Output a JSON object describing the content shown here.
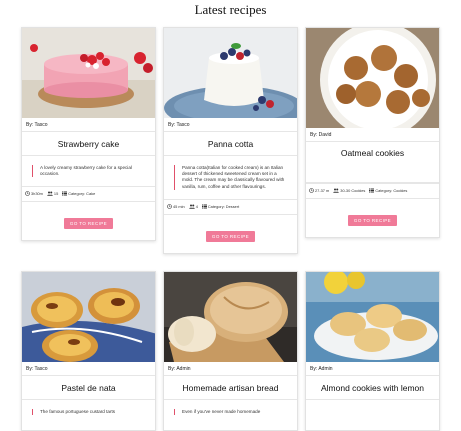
{
  "page": {
    "title": "Latest recipes"
  },
  "colors": {
    "accent": "#f07a98",
    "quote_bar": "#e0506a"
  },
  "recipes": [
    {
      "author": "By: Tasco",
      "title": "Strawberry cake",
      "description": "A lovely creamy strawberry cake for a special occasion.",
      "time": "3h30m",
      "servings": "15",
      "category": "Category: Cake",
      "button": "GO TO RECIPE"
    },
    {
      "author": "By: Tasco",
      "title": "Panna cotta",
      "description": "Panna cotta(Italian for cooked cream) is an Italian dessert of thickened sweetened cream set in a mold. The cream may be classically flavoured with vanilla, rum, coffee and other flavourings.",
      "time": "45 min",
      "servings": "4",
      "category": "Category: Dessert",
      "button": "GO TO RECIPE"
    },
    {
      "author": "By: David",
      "title": "Oatmeal cookies",
      "description": "",
      "time": "27-37 m",
      "servings": "30-30 Cookies",
      "category": "Category: Cookies",
      "button": "GO TO RECIPE"
    },
    {
      "author": "By: Tasco",
      "title": "Pastel de nata",
      "description": "The famous portuguese custard tarts"
    },
    {
      "author": "By: Admin",
      "title": "Homemade artisan bread",
      "description": "Even if you've never made homemade"
    },
    {
      "author": "By: Admin",
      "title": "Almond cookies with lemon"
    }
  ]
}
